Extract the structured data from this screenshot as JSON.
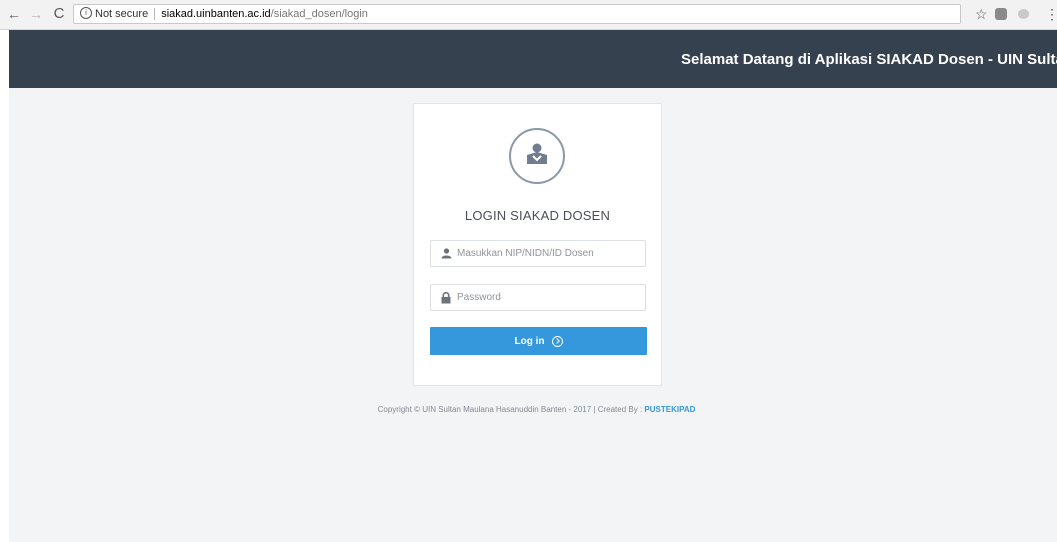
{
  "browser": {
    "nav": {
      "back": "←",
      "forward": "→",
      "reload": "C"
    },
    "security": {
      "icon": "ⓘ",
      "label": "Not secure"
    },
    "url": {
      "host": "siakad.uinbanten.ac.id",
      "path": "/siakad_dosen/login"
    },
    "icons": {
      "bookmark": "☆",
      "menu": "⋮"
    }
  },
  "header": {
    "welcome": "Selamat Datang di Aplikasi SIAKAD Dosen - UIN Sultan Maulana Hasanuddin Banten",
    "background": "#364150"
  },
  "login": {
    "title": "LOGIN SIAKAD DOSEN",
    "username_placeholder": "Masukkan NIP/NIDN/ID Dosen",
    "username_value": "",
    "password_placeholder": "Password",
    "password_value": "",
    "button_label": "Log in",
    "accent": "#3598dc"
  },
  "footer": {
    "copyright": "Copyright © UIN Sultan Maulana Hasanuddin Banten - 2017 | Created By : ",
    "creator_link": "PUSTEKIPAD"
  }
}
